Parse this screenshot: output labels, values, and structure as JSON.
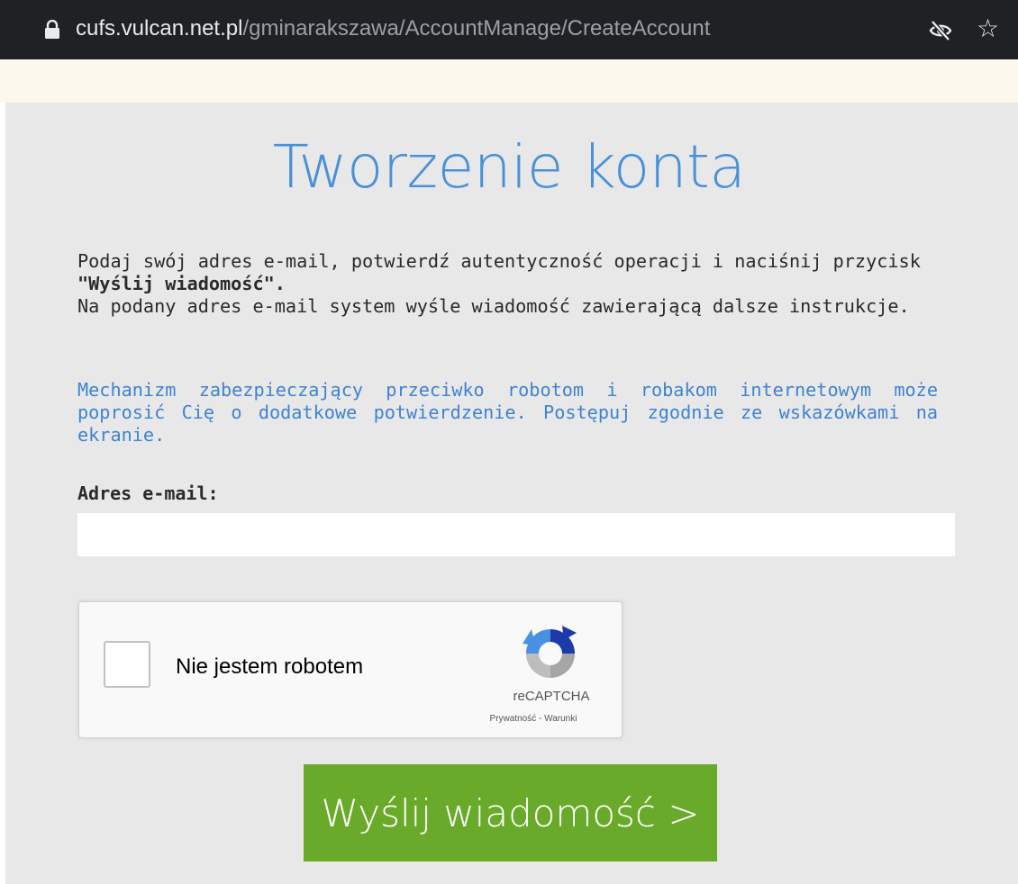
{
  "browser": {
    "url_host": "cufs.vulcan.net.pl",
    "url_path": "/gminarakszawa/AccountManage/CreateAccount",
    "icons": [
      "lock-icon",
      "eye-off-icon",
      "star-icon"
    ]
  },
  "page": {
    "title": "Tworzenie konta",
    "intro_line1": "Podaj swój adres e-mail, potwierdź autentyczność operacji i naciśnij przycisk",
    "intro_bold": "\"Wyślij wiadomość\".",
    "intro_line2": "Na podany adres e-mail system wyśle wiadomość zawierającą dalsze instrukcje.",
    "note": "Mechanizm zabezpieczający przeciwko robotom i robakom internetowym może poprosić Cię o dodatkowe potwierdzenie. Postępuj zgodnie ze wskazówkami na ekranie.",
    "email_label": "Adres e-mail:",
    "email_value": "",
    "captcha": {
      "checkbox_label": "Nie jestem robotem",
      "brand": "reCAPTCHA",
      "privacy": "Prywatność",
      "separator": " - ",
      "terms": "Warunki"
    },
    "send_button": "Wyślij wiadomość >"
  },
  "colors": {
    "title": "#4a90d9",
    "note": "#3f83d1",
    "button": "#6aaa2a",
    "panel": "#e8e8e8"
  }
}
